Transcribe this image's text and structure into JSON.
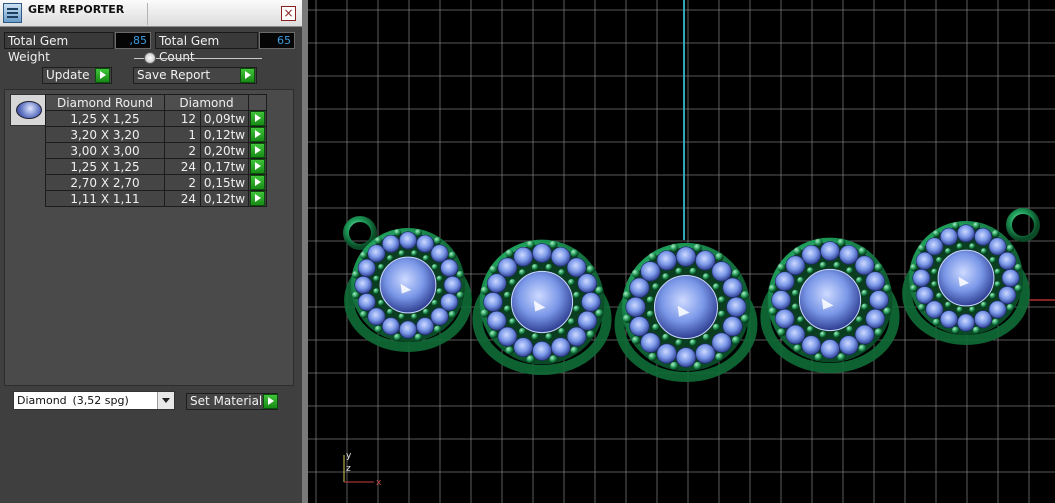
{
  "window": {
    "title": "GEM REPORTER",
    "close_icon": "close-icon"
  },
  "summary": {
    "weight_label": "Total Gem Weight",
    "weight_value": ",85",
    "count_label": "Total Gem Count",
    "count_value": "65"
  },
  "toolbar": {
    "update_label": "Update",
    "save_label": "Save Report"
  },
  "gems": {
    "thumb_icon": "gem-icon",
    "headers": [
      "Diamond Round",
      "Diamond"
    ],
    "rows": [
      {
        "size": "1,25 X 1,25",
        "count": "12",
        "weight": "0,09tw"
      },
      {
        "size": "3,20 X 3,20",
        "count": "1",
        "weight": "0,12tw"
      },
      {
        "size": "3,00 X 3,00",
        "count": "2",
        "weight": "0,20tw"
      },
      {
        "size": "1,25 X 1,25",
        "count": "24",
        "weight": "0,17tw"
      },
      {
        "size": "2,70 X 2,70",
        "count": "2",
        "weight": "0,15tw"
      },
      {
        "size": "1,11 X 1,11",
        "count": "24",
        "weight": "0,12tw"
      }
    ]
  },
  "material": {
    "selected_name": "Diamond",
    "selected_density": "(3,52 spg)",
    "set_label": "Set Material"
  },
  "viewport": {
    "axis_labels": {
      "y": "y",
      "z": "z",
      "x": "x"
    },
    "colors": {
      "gem": "#6f8ee0",
      "metal": "#19a35a",
      "grid": "#8a8a8a"
    }
  }
}
